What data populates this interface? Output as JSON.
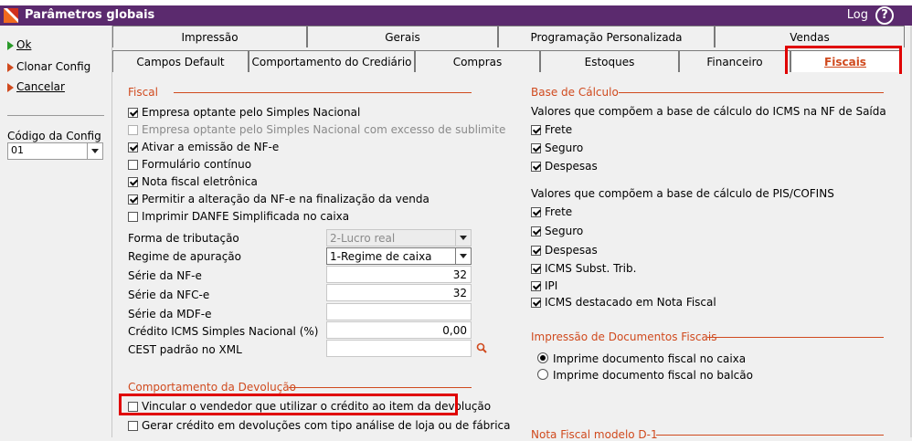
{
  "window": {
    "title": "Parâmetros globais",
    "log_label": "Log",
    "help_glyph": "?"
  },
  "left": {
    "ok": "Ok",
    "clone": "Clonar Config",
    "cancel": "Cancelar",
    "config_label": "Código da Config",
    "config_value": "01"
  },
  "tabs_row1": [
    "Impressão",
    "Gerais",
    "Programação Personalizada",
    "Vendas"
  ],
  "tabs_row2": [
    "Campos Default",
    "Comportamento do Crediário",
    "Compras",
    "Estoques",
    "Financeiro",
    "Fiscais"
  ],
  "fiscal": {
    "title": "Fiscal",
    "items": [
      {
        "label": "Empresa optante pelo Simples Nacional",
        "checked": true
      },
      {
        "label": "Empresa optante pelo Simples Nacional com excesso de sublimite",
        "checked": false
      },
      {
        "label": "Ativar a emissão de NF-e",
        "checked": true
      },
      {
        "label": "Formulário contínuo",
        "checked": false
      },
      {
        "label": "Nota fiscal eletrônica",
        "checked": true
      },
      {
        "label": "Permitir a alteração da NF-e na finalização da venda",
        "checked": true
      },
      {
        "label": "Imprimir DANFE Simplificada no caixa",
        "checked": false
      }
    ],
    "fields": {
      "forma_label": "Forma de tributação",
      "forma_value": "2-Lucro real",
      "regime_label": "Regime de apuração",
      "regime_value": "1-Regime de caixa",
      "serie_nfe_label": "Série da NF-e",
      "serie_nfe_value": "32",
      "serie_nfce_label": "Série da NFC-e",
      "serie_nfce_value": "32",
      "serie_mdfe_label": "Série da MDF-e",
      "serie_mdfe_value": "",
      "credito_label": "Crédito ICMS Simples Nacional (%)",
      "credito_value": "0,00",
      "cest_label": "CEST padrão no XML",
      "cest_value": ""
    }
  },
  "devolucao": {
    "title": "Comportamento da Devolução",
    "items": [
      {
        "label": "Vincular o vendedor que utilizar o crédito ao item da devolução",
        "checked": false
      },
      {
        "label": "Gerar crédito em devoluções com tipo análise de loja ou de fábrica",
        "checked": false
      }
    ]
  },
  "base_calculo": {
    "title": "Base de Cálculo",
    "icms_label": "Valores que compõem a base de cálculo do ICMS na NF de Saída",
    "icms_items": [
      {
        "label": "Frete",
        "checked": true
      },
      {
        "label": "Seguro",
        "checked": true
      },
      {
        "label": "Despesas",
        "checked": true
      }
    ],
    "pis_label": "Valores que compõem a base de cálculo de PIS/COFINS",
    "pis_items": [
      {
        "label": "Frete",
        "checked": true
      },
      {
        "label": "Seguro",
        "checked": true
      },
      {
        "label": "Despesas",
        "checked": true
      },
      {
        "label": "ICMS Subst. Trib.",
        "checked": true
      },
      {
        "label": "IPI",
        "checked": true
      },
      {
        "label": "ICMS destacado em Nota Fiscal",
        "checked": true
      }
    ]
  },
  "impressao_docs": {
    "title": "Impressão de Documentos Fiscais",
    "options": [
      {
        "label": "Imprime documento fiscal no caixa",
        "selected": true
      },
      {
        "label": "Imprime documento fiscal no balcão",
        "selected": false
      }
    ]
  },
  "nf_d1": {
    "title": "Nota Fiscal modelo D-1"
  },
  "colors": {
    "title_bar": "#5b2a6e",
    "accent": "#d04a1e",
    "highlight": "#e00000",
    "ok_arrow": "#2a9a2a",
    "other_arrow": "#d04a1e"
  }
}
